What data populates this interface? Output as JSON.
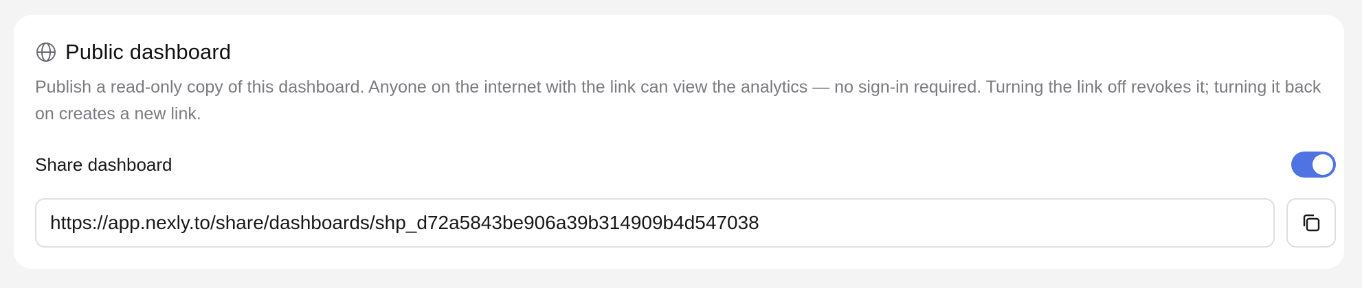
{
  "section": {
    "title": "Public dashboard",
    "title_icon": "globe-icon",
    "description": "Publish a read-only copy of this dashboard. Anyone on the internet with the link can view the analytics — no sign-in required. Turning the link off revokes it; turning it back on creates a new link."
  },
  "share": {
    "label": "Share dashboard",
    "enabled": true,
    "toggle_color": "#4f73e3"
  },
  "link": {
    "url": "https://app.nexly.to/share/dashboards/shp_d72a5843be906a39b314909b4d547038",
    "copy_icon": "copy-icon"
  }
}
